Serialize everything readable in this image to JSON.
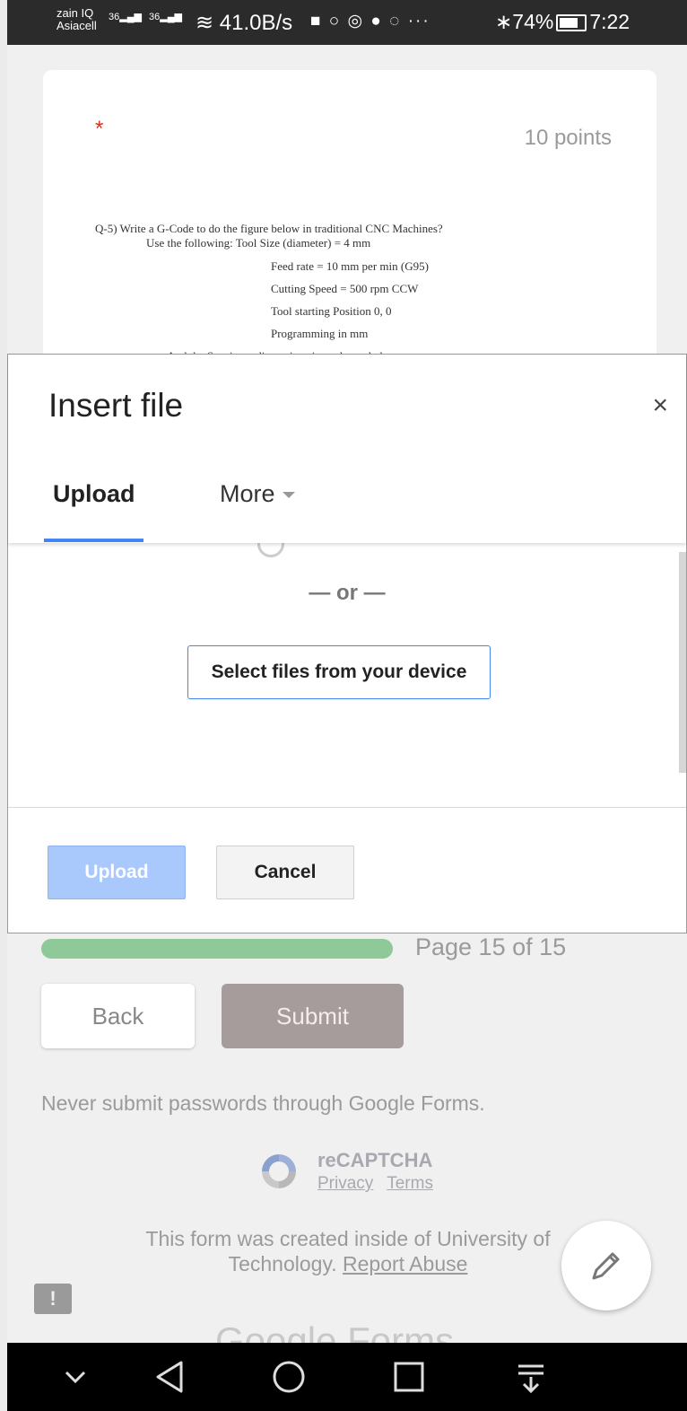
{
  "status_bar": {
    "carrier_line1": "zain IQ",
    "carrier_line2": "Asiacell",
    "sig1": "36",
    "sig2": "36",
    "speed": "41.0B/s",
    "app_icons": "■ ○ ◎ ● ◌ ···",
    "battery_percent": "74%",
    "time": "7:22"
  },
  "question": {
    "required_mark": "*",
    "points": "10 points",
    "line1": "Q-5) Write a G-Code to do the figure below in traditional CNC Machines?",
    "line2": "Use the following:     Tool Size (diameter) = 4 mm",
    "line3": "Feed rate = 10 mm per min (G95)",
    "line4": "Cutting Speed = 500 rpm CCW",
    "line5": "Tool starting Position 0, 0",
    "line6": "Programming in mm",
    "line7": "And the Specimen dimensions is as shown below:"
  },
  "dialog": {
    "title": "Insert file",
    "close_label": "×",
    "tabs": [
      {
        "label": "Upload",
        "active": true
      },
      {
        "label": "More",
        "active": false
      }
    ],
    "or_label": "— or —",
    "select_files_label": "Select files from your device",
    "upload_label": "Upload",
    "cancel_label": "Cancel"
  },
  "form_footer": {
    "progress_fraction": 1.0,
    "page_text": "Page 15 of 15",
    "back_label": "Back",
    "submit_label": "Submit",
    "warning": "Never submit passwords through Google Forms.",
    "recaptcha_title": "reCAPTCHA",
    "privacy_label": "Privacy",
    "terms_label": "Terms",
    "created_line1": "This form was created inside of University of",
    "created_line2": "Technology.",
    "report_abuse_label": "Report Abuse",
    "google_forms_label": "Google Forms"
  },
  "colors": {
    "accent_blue": "#4285f4",
    "required_red": "#d93025",
    "progress_green": "#8fc99a",
    "upload_disabled": "#a9c8fb"
  },
  "icons": {
    "close": "close-icon",
    "dropdown": "chevron-down-icon",
    "feedback": "feedback-icon",
    "edit": "pencil-icon",
    "nav": [
      "chevron-down-icon",
      "back-triangle-icon",
      "home-circle-icon",
      "recents-square-icon",
      "notification-pull-icon"
    ]
  }
}
